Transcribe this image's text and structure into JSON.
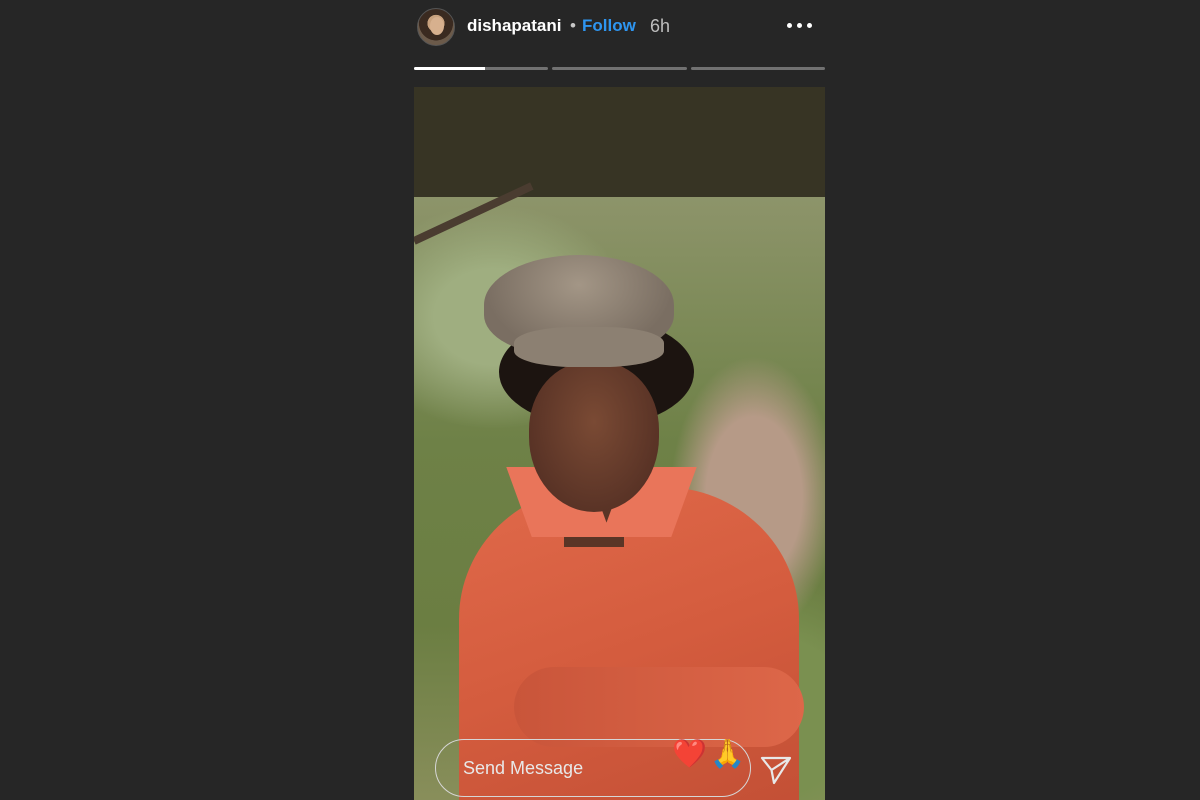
{
  "header": {
    "username": "dishapatani",
    "separator": "•",
    "follow_label": "Follow",
    "time": "6h",
    "more_icon": "more-horizontal-icon"
  },
  "progress": {
    "segments": 3,
    "active_index": 0,
    "active_fraction": 0.53
  },
  "story": {
    "photo_subject": "photo"
  },
  "reply": {
    "placeholder": "Send Message",
    "quick_reactions": [
      "❤️",
      "🙏"
    ],
    "send_icon": "send-paper-plane-icon"
  },
  "colors": {
    "background": "#262626",
    "follow": "#2e95f0",
    "frame": "#373424"
  }
}
